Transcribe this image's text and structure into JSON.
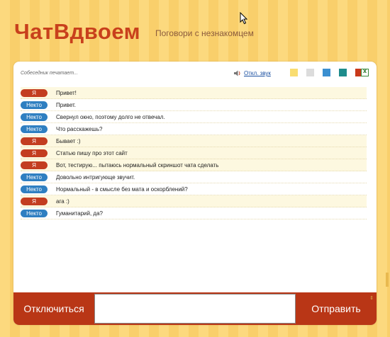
{
  "header": {
    "logo_text": "ЧатВдвоем",
    "tagline": "Поговори с незнакомцем"
  },
  "status": {
    "typing_text": "Собеседник печатает...",
    "sound_toggle_label": "Откл. звук"
  },
  "theme_swatches": [
    "#f9dd71",
    "#dcdcdc",
    "#3b8fd0",
    "#1e8c8c",
    "#c9391a"
  ],
  "export_icon": "excel-icon",
  "messages": [
    {
      "sender": "Я",
      "from": "me",
      "text": "Привет!"
    },
    {
      "sender": "Некто",
      "from": "other",
      "text": "Привет."
    },
    {
      "sender": "Некто",
      "from": "other",
      "text": "Свернул окно, поэтому долго не отвечал."
    },
    {
      "sender": "Некто",
      "from": "other",
      "text": "Что расскажешь?"
    },
    {
      "sender": "Я",
      "from": "me",
      "text": "Бывает :)"
    },
    {
      "sender": "Я",
      "from": "me",
      "text": "Статью пишу про этот сайт"
    },
    {
      "sender": "Я",
      "from": "me",
      "text": "Вот, тестирую... пытаюсь нормальный скриншот чата сделать"
    },
    {
      "sender": "Некто",
      "from": "other",
      "text": "Довольно интригующе звучит."
    },
    {
      "sender": "Некто",
      "from": "other",
      "text": "Нормальный - в смысле без мата и оскорблений?"
    },
    {
      "sender": "Я",
      "from": "me",
      "text": "ага :)"
    },
    {
      "sender": "Некто",
      "from": "other",
      "text": "Гуманитарий, да?"
    }
  ],
  "composer": {
    "disconnect_label": "Отключиться",
    "send_label": "Отправить",
    "input_value": ""
  },
  "colors": {
    "brand_red": "#c8401c",
    "me_tag": "#c33d20",
    "other_tag": "#2f7fc1",
    "bottom_bar": "#b93616"
  }
}
